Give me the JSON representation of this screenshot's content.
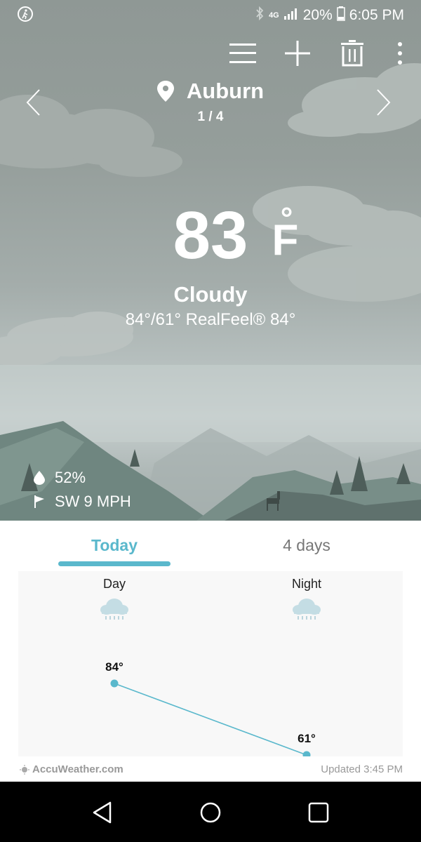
{
  "status_bar": {
    "network": "4G",
    "battery": "20%",
    "time": "6:05 PM"
  },
  "toolbar": {
    "icons": [
      "menu-icon",
      "add-icon",
      "delete-icon",
      "more-icon"
    ]
  },
  "location": {
    "name": "Auburn",
    "page": "1 / 4"
  },
  "current": {
    "temp": "83",
    "deg": "°",
    "unit": "F",
    "condition": "Cloudy",
    "details": "84°/61° RealFeel® 84°",
    "humidity": "52%",
    "wind": "SW 9 MPH"
  },
  "tabs": {
    "today": "Today",
    "four_days": "4 days"
  },
  "forecast": {
    "day_label": "Day",
    "night_label": "Night",
    "day_icon": "rain-cloud-icon",
    "night_icon": "rain-cloud-icon"
  },
  "chart_data": {
    "type": "line",
    "categories": [
      "Day",
      "Night"
    ],
    "values": [
      84,
      61
    ],
    "value_labels": [
      "84°",
      "61°"
    ],
    "ylim": [
      61,
      84
    ]
  },
  "footer": {
    "brand": "AccuWeather.com",
    "updated": "Updated 3:45 PM"
  },
  "colors": {
    "accent": "#5ab8cc",
    "navbar": "#000000"
  }
}
